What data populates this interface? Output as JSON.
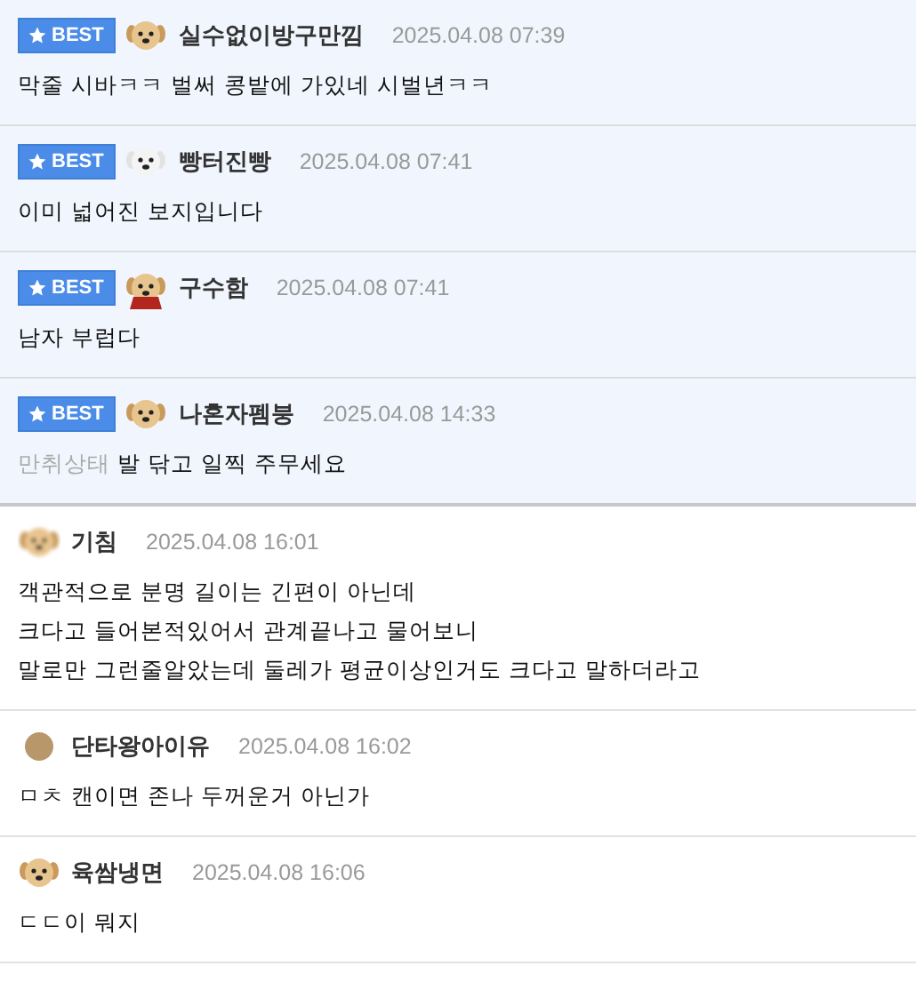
{
  "comments": [
    {
      "best": true,
      "avatar": {
        "kind": "puppy"
      },
      "badge": "BEST",
      "author": "실수없이방구만낌",
      "date": "2025.04.08 07:39",
      "lines": [
        "막줄 시바ㅋㅋ 벌써 콩밭에 가있네 시벌년ㅋㅋ"
      ]
    },
    {
      "best": true,
      "avatar": {
        "kind": "white-dog"
      },
      "badge": "BEST",
      "author": "빵터진빵",
      "date": "2025.04.08 07:41",
      "lines": [
        "이미 넓어진 보지입니다"
      ]
    },
    {
      "best": true,
      "avatar": {
        "kind": "caped-puppy"
      },
      "badge": "BEST",
      "author": "구수함",
      "date": "2025.04.08 07:41",
      "lines": [
        "남자 부럽다"
      ]
    },
    {
      "best": true,
      "avatar": {
        "kind": "puppy"
      },
      "badge": "BEST",
      "author": "나혼자펨붕",
      "date": "2025.04.08 14:33",
      "mention": "만취상태",
      "lines": [
        "발 닦고 일찍 주무세요"
      ]
    },
    {
      "best": false,
      "avatar": {
        "kind": "blurred-puppy"
      },
      "author": "기침",
      "date": "2025.04.08 16:01",
      "lines": [
        "객관적으로 분명 길이는 긴편이 아닌데",
        "크다고 들어본적있어서 관계끝나고 물어보니",
        "말로만 그런줄알았는데 둘레가 평균이상인거도 크다고 말하더라고"
      ]
    },
    {
      "best": false,
      "avatar": {
        "kind": "circle"
      },
      "author": "단타왕아이유",
      "date": "2025.04.08 16:02",
      "lines": [
        "ㅁㅊ 캔이면 존나 두꺼운거 아닌가"
      ]
    },
    {
      "best": false,
      "avatar": {
        "kind": "puppy"
      },
      "author": "육쌈냉면",
      "date": "2025.04.08 16:06",
      "lines": [
        "ㄷㄷ이 뭐지"
      ]
    }
  ]
}
